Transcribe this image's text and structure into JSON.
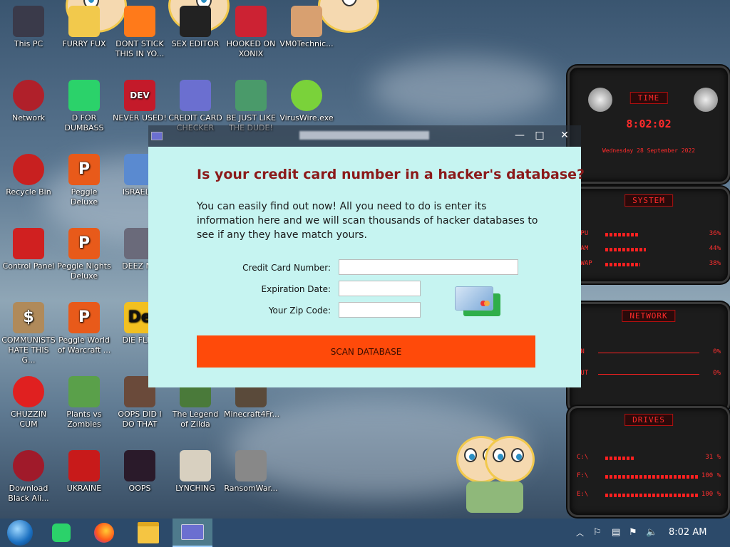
{
  "desktop_icons": [
    {
      "label": "This PC",
      "icon": "computer-icon"
    },
    {
      "label": "FURRY FUX",
      "icon": "cartoon-icon"
    },
    {
      "label": "DONT STICK THIS IN YO...",
      "icon": "cone-icon"
    },
    {
      "label": "SEX EDITOR",
      "icon": "editor-icon"
    },
    {
      "label": "HOOKED ON XONIX",
      "icon": "game-icon"
    },
    {
      "label": "VM0Technic...",
      "icon": "doctor-icon"
    },
    {
      "label": "Network",
      "icon": "network-icon"
    },
    {
      "label": "D FOR DUMBASS",
      "icon": "green-chat-icon"
    },
    {
      "label": "NEVER USED!",
      "icon": "dev-cpp-icon"
    },
    {
      "label": "CREDIT CARD CHECKER",
      "icon": "credit-card-icon"
    },
    {
      "label": "BE JUST LIKE THE DUDE!",
      "icon": "elf-icon"
    },
    {
      "label": "VirusWire.exe",
      "icon": "lime-icon"
    },
    {
      "label": "Recycle Bin",
      "icon": "recycle-bin-icon"
    },
    {
      "label": "Peggle Deluxe",
      "icon": "peggle-icon"
    },
    {
      "label": "ISRAEL S",
      "icon": "israel-icon"
    },
    {
      "label": "Control Panel",
      "icon": "control-panel-icon"
    },
    {
      "label": "Peggle Nights Deluxe",
      "icon": "peggle-icon"
    },
    {
      "label": "DEEZ NU",
      "icon": "windows-icon"
    },
    {
      "label": "COMMUNISTS HATE THIS G...",
      "icon": "money-bag-icon"
    },
    {
      "label": "Peggle World of Warcraft ...",
      "icon": "peggle-icon"
    },
    {
      "label": "DIE FLEA",
      "icon": "die-icon"
    },
    {
      "label": "CHUZZIN CUM",
      "icon": "chuzzle-icon"
    },
    {
      "label": "Plants vs Zombies",
      "icon": "plant-icon"
    },
    {
      "label": "OOPS DID I DO THAT",
      "icon": "portrait-icon"
    },
    {
      "label": "The Legend of Zilda",
      "icon": "zelda-icon"
    },
    {
      "label": "Minecraft4Fr...",
      "icon": "minecraft-icon"
    },
    {
      "label": "Download Black Ali...",
      "icon": "alien-icon"
    },
    {
      "label": "UKRAINE",
      "icon": "radiation-icon"
    },
    {
      "label": "OOPS",
      "icon": "oops-icon"
    },
    {
      "label": "LYNCHING",
      "icon": "noose-icon"
    },
    {
      "label": "RansomWar...",
      "icon": "skull-icon"
    }
  ],
  "window": {
    "title": "",
    "minimize_label": "—",
    "maximize_label": "□",
    "close_label": "✕",
    "headline": "Is your credit card number in a hacker's database?",
    "intro": "You can easily find out now! All you need to do is enter its information here and we will scan thousands of hacker databases to see if any they have match yours.",
    "fields": {
      "card_number_label": "Credit Card Number:",
      "card_number_value": "",
      "expiration_label": "Expiration Date:",
      "expiration_value": "",
      "zip_label": "Your Zip Code:",
      "zip_value": ""
    },
    "scan_button": "SCAN DATABASE",
    "cards_icon": "credit-cards-icon"
  },
  "gadget": {
    "time_title": "TIME",
    "time_value": "8:02:02",
    "date_value": "Wednesday 28 September 2022",
    "system_title": "SYSTEM",
    "system_rows": [
      {
        "label": "CPU",
        "value": "36%",
        "fill": 0.36
      },
      {
        "label": "RAM",
        "value": "44%",
        "fill": 0.44
      },
      {
        "label": "SWAP",
        "value": "38%",
        "fill": 0.38
      }
    ],
    "network_title": "NETWORK",
    "network_rows": [
      {
        "label": "IN",
        "value": "0%"
      },
      {
        "label": "OUT",
        "value": "0%"
      }
    ],
    "drives_title": "DRIVES",
    "drive_rows": [
      {
        "label": "C:\\",
        "value": "31 %",
        "fill": 0.31
      },
      {
        "label": "F:\\",
        "value": "100 %",
        "fill": 1.0
      },
      {
        "label": "E:\\",
        "value": "100 %",
        "fill": 1.0
      }
    ],
    "accent": "#ff2b2b"
  },
  "taskbar": {
    "apps": [
      "start-orb-icon",
      "green-chat-icon",
      "firefox-icon",
      "file-explorer-icon",
      "credit-card-app-icon"
    ],
    "clock": "8:02 AM",
    "tray_icons": [
      "chevron-up-icon",
      "flag-icon",
      "action-center-icon",
      "network-icon",
      "volume-icon"
    ]
  }
}
